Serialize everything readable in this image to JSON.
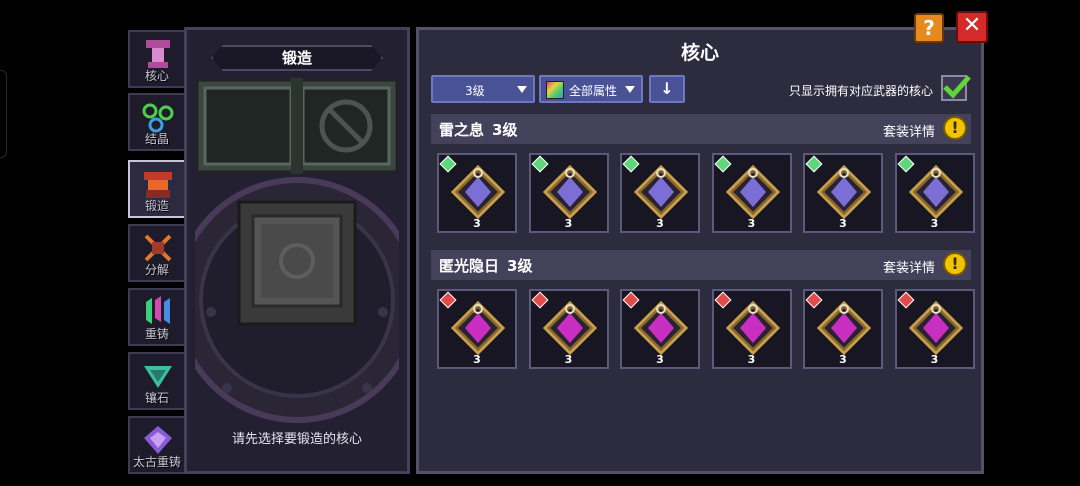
{
  "tabs": [
    {
      "label": "核心",
      "icon": "core-tab-icon",
      "active": false
    },
    {
      "label": "结晶",
      "icon": "crystal-tab-icon",
      "active": false
    },
    {
      "label": "锻造",
      "icon": "forge-tab-icon",
      "active": true
    },
    {
      "label": "分解",
      "icon": "decompose-tab-icon",
      "active": false
    },
    {
      "label": "重铸",
      "icon": "recast-tab-icon",
      "active": false
    },
    {
      "label": "镶石",
      "icon": "inlay-tab-icon",
      "active": false
    },
    {
      "label": "太古重铸",
      "icon": "ancient-recast-tab-icon",
      "active": false
    }
  ],
  "forge": {
    "title": "锻造",
    "hint": "请先选择要锻造的核心"
  },
  "core": {
    "title": "核心",
    "level_filter": "3级",
    "attr_filter": "全部属性",
    "owned_filter_label": "只显示拥有对应武器的核心",
    "owned_filter_checked": true
  },
  "sets": [
    {
      "name": "雷之息",
      "level": "3级",
      "detail_label": "套装详情",
      "gem_color": "#5fd67a",
      "emblem_color": "#7b6fd6",
      "items": [
        {
          "level": "3"
        },
        {
          "level": "3"
        },
        {
          "level": "3"
        },
        {
          "level": "3"
        },
        {
          "level": "3"
        },
        {
          "level": "3"
        }
      ]
    },
    {
      "name": "匿光隐日",
      "level": "3级",
      "detail_label": "套装详情",
      "gem_color": "#e04b4b",
      "emblem_color": "#c82ec0",
      "items": [
        {
          "level": "3"
        },
        {
          "level": "3"
        },
        {
          "level": "3"
        },
        {
          "level": "3"
        },
        {
          "level": "3"
        },
        {
          "level": "3"
        }
      ]
    }
  ],
  "buttons": {
    "help": "?",
    "close": "✕",
    "sort": "↓"
  },
  "colors": {
    "accent": "#4a5296",
    "help": "#e68a1f",
    "close": "#d32a2a",
    "exclaim": "#f0c400"
  }
}
